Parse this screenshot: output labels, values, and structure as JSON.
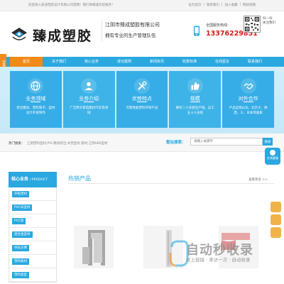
{
  "topbar": {
    "welcome": "欢迎进入安迪塑胶设计有限公司官网！我们将竭诚为您服务！",
    "links": [
      "设为首页",
      "|",
      "联系我们",
      "|",
      "加入收藏",
      "|",
      "网站地图"
    ]
  },
  "header": {
    "logo_text": "臻成塑胶",
    "company_name": "江阴市臻成塑胶有限公司",
    "slogan": "拥有专业的生产管理队伍",
    "hotline_label": "全国服务热线：",
    "hotline_number": "13376229851",
    "qr_caption": [
      "扫一扫",
      "关注我们"
    ]
  },
  "nav": {
    "items": [
      "首页",
      "关于我们",
      "核心业务",
      "成功案例",
      "新闻资讯",
      "收费标准",
      "在线留言",
      "联系我们"
    ],
    "active_index": 0
  },
  "side_tab": "分享",
  "features": [
    {
      "title": "业务领域",
      "desc": "挤出模具、塑料管子、型材设计开发制作",
      "icon": "globe-icon"
    },
    {
      "title": "业务介绍",
      "desc": "广泛用于家电建材汽车等领域",
      "icon": "person-icon"
    },
    {
      "title": "优势特点",
      "desc": "可靠性能塑料环保产品",
      "icon": "tools-icon"
    },
    {
      "title": "规模",
      "desc": "拥有二十多套生产线，员工五十人员组",
      "icon": "thumbs-up-icon"
    },
    {
      "title": "对外合作",
      "desc": "产品远销山东、北京大、陕西，三、日本等国家",
      "icon": "handshake-icon"
    }
  ],
  "hot_search": {
    "label": "热门搜索：",
    "words": "江阴塑料型材,PVC模具挤出,木塑型材,管材,江阴ABS型材",
    "search_label": "整站搜索：",
    "placeholder": "请输入关键字",
    "button": "搜索"
  },
  "service_float": "在线客服",
  "sidebar": {
    "title": "核心业务",
    "title_en": "/ PRODUCT",
    "items": [
      "开拓塑材",
      "PVC异型材",
      "PVC管",
      "铝合金型材",
      "导轨支撑",
      "塑料板材",
      "塑料类型"
    ]
  },
  "main": {
    "hot_title": "热销产品",
    "more": "查看更多 >>"
  },
  "watermark": {
    "text": "自动秒收录",
    "sub": "收上链接 · 来访一次 · 自动收录"
  },
  "colors": {
    "primary": "#2aa8e0",
    "accent": "#f28a17",
    "hotline": "#d41c1c"
  }
}
